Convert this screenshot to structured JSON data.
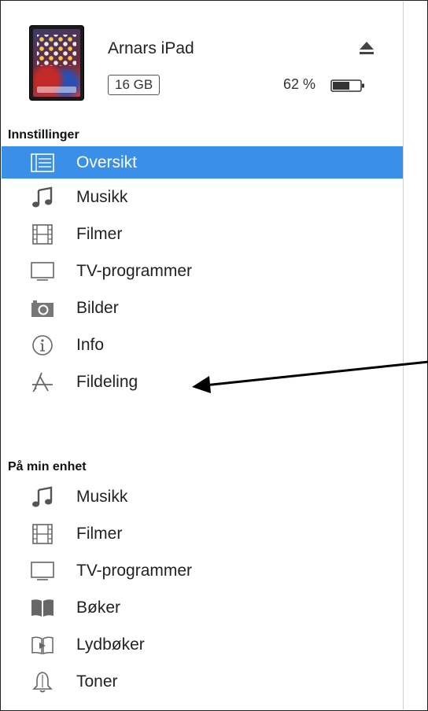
{
  "device": {
    "name": "Arnars iPad",
    "capacity": "16 GB",
    "battery_percent": "62 %",
    "battery_level": 0.62
  },
  "settings": {
    "title": "Innstillinger",
    "items": [
      {
        "label": "Oversikt",
        "icon": "list-icon",
        "selected": true
      },
      {
        "label": "Musikk",
        "icon": "music-note-icon"
      },
      {
        "label": "Filmer",
        "icon": "film-icon"
      },
      {
        "label": "TV-programmer",
        "icon": "tv-icon"
      },
      {
        "label": "Bilder",
        "icon": "camera-icon"
      },
      {
        "label": "Info",
        "icon": "info-icon"
      },
      {
        "label": "Fildeling",
        "icon": "app-store-icon"
      }
    ]
  },
  "on_device": {
    "title": "På min enhet",
    "items": [
      {
        "label": "Musikk",
        "icon": "music-note-icon"
      },
      {
        "label": "Filmer",
        "icon": "film-icon"
      },
      {
        "label": "TV-programmer",
        "icon": "tv-icon"
      },
      {
        "label": "Bøker",
        "icon": "book-icon"
      },
      {
        "label": "Lydbøker",
        "icon": "audiobook-icon"
      },
      {
        "label": "Toner",
        "icon": "bell-icon"
      }
    ]
  },
  "colors": {
    "selection": "#3a8fe9",
    "icon": "#666666"
  }
}
